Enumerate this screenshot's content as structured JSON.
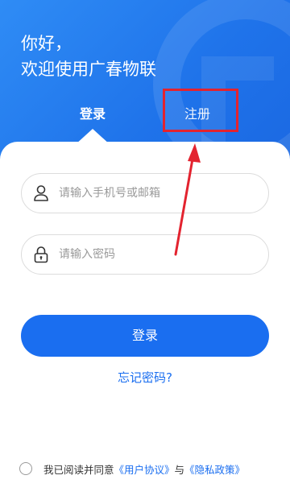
{
  "greeting": {
    "line1": "你好，",
    "line2": "欢迎使用广春物联"
  },
  "tabs": {
    "login": "登录",
    "register": "注册"
  },
  "form": {
    "phone_placeholder": "请输入手机号或邮箱",
    "password_placeholder": "请输入密码",
    "login_button": "登录",
    "forgot_link": "忘记密码?"
  },
  "agreement": {
    "prefix": "我已阅读并同意",
    "user_agreement": "《用户协议》",
    "and": "与",
    "privacy_policy": "《隐私政策》"
  },
  "colors": {
    "brand_blue": "#1a6ef0",
    "annotation_red": "#e3232f"
  },
  "icons": {
    "phone_field": "user-icon",
    "password_field": "lock-icon"
  }
}
